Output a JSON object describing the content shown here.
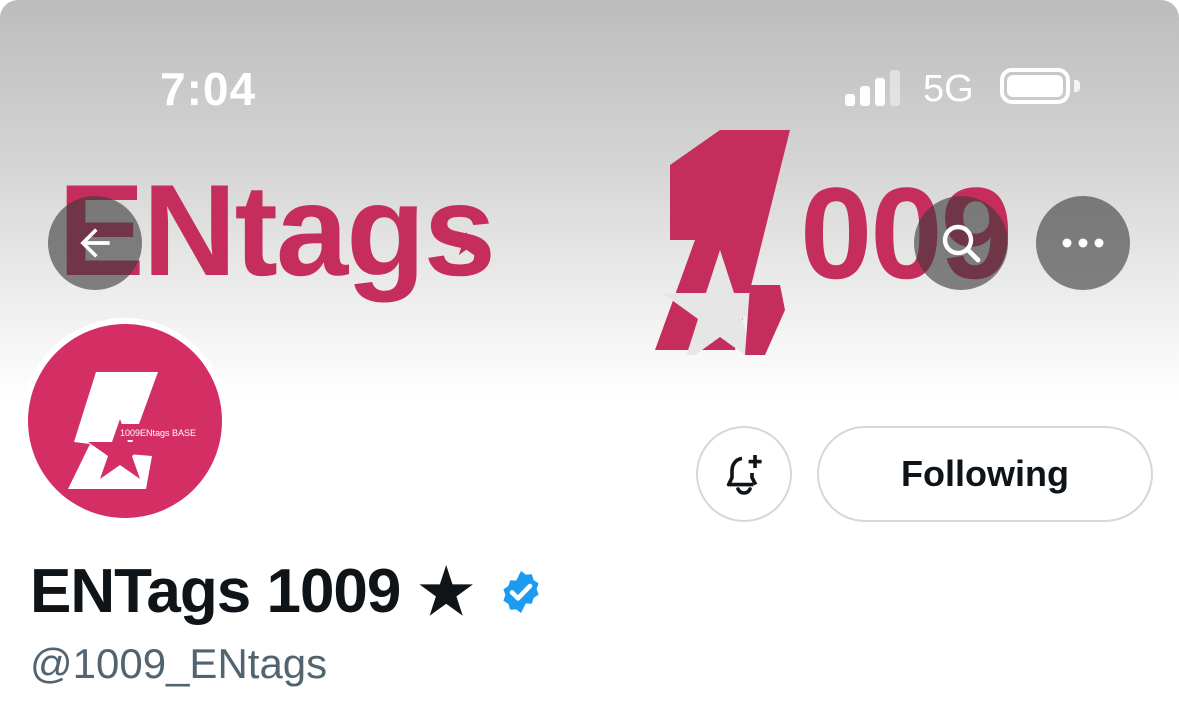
{
  "status_bar": {
    "time": "7:04",
    "network": "5G",
    "icons": [
      "signal-icon",
      "battery-icon"
    ]
  },
  "banner": {
    "text_left": "ENtags",
    "text_right": "009",
    "numeral": "1",
    "brand_color": "#c52e5c"
  },
  "header_actions": {
    "back_icon": "back-arrow-icon",
    "search_icon": "search-icon",
    "more_icon": "more-icon"
  },
  "avatar": {
    "label": "1009ENtags BASE",
    "color": "#d42f65"
  },
  "actions": {
    "notify_icon": "bell-plus-icon",
    "following_label": "Following"
  },
  "profile": {
    "display_name": "ENTags 1009",
    "name_emoji": "★",
    "verified": true,
    "verified_color": "#1d9bf0",
    "handle": "@1009_ENtags"
  }
}
